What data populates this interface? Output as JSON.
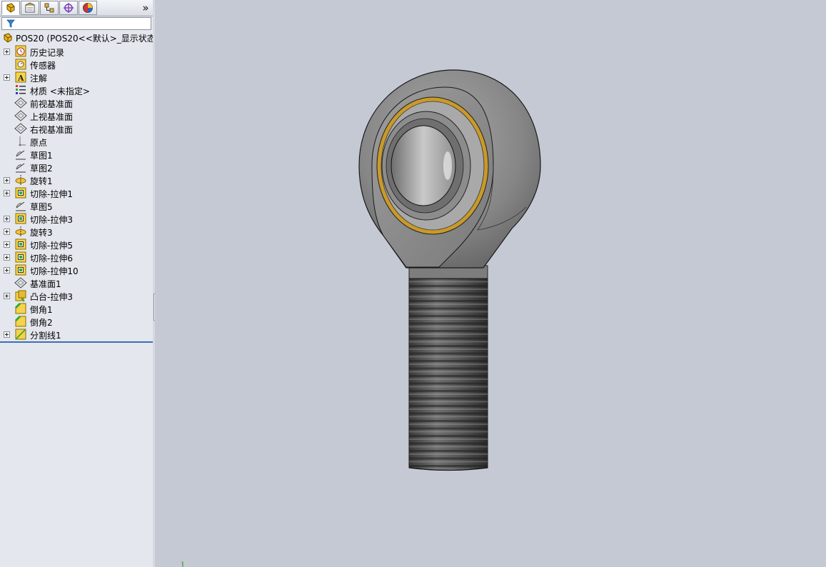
{
  "tabs": [
    {
      "name": "featuremanager",
      "icon": "part-icon",
      "active": true
    },
    {
      "name": "propertymanager",
      "icon": "property-icon",
      "active": false
    },
    {
      "name": "configurationmanager",
      "icon": "configuration-icon",
      "active": false
    },
    {
      "name": "dimxpert",
      "icon": "crosshair-icon",
      "active": false
    },
    {
      "name": "display-manager",
      "icon": "appearance-icon",
      "active": false
    }
  ],
  "tab_more_label": "»",
  "root": {
    "label": "POS20  (POS20<<默认>_显示状态"
  },
  "tree": [
    {
      "label": "历史记录",
      "icon": "history-icon",
      "expandable": true
    },
    {
      "label": "传感器",
      "icon": "sensor-icon",
      "expandable": false
    },
    {
      "label": "注解",
      "icon": "annotation-icon",
      "expandable": true
    },
    {
      "label": "材质 <未指定>",
      "icon": "material-icon",
      "expandable": false
    },
    {
      "label": "前视基准面",
      "icon": "plane-icon",
      "expandable": false
    },
    {
      "label": "上视基准面",
      "icon": "plane-icon",
      "expandable": false
    },
    {
      "label": "右视基准面",
      "icon": "plane-icon",
      "expandable": false
    },
    {
      "label": "原点",
      "icon": "origin-icon",
      "expandable": false
    },
    {
      "label": "草图1",
      "icon": "sketch-icon",
      "expandable": false
    },
    {
      "label": "草图2",
      "icon": "sketch-icon",
      "expandable": false
    },
    {
      "label": "旋转1",
      "icon": "revolve-icon",
      "expandable": true
    },
    {
      "label": "切除-拉伸1",
      "icon": "cut-extrude-icon",
      "expandable": true
    },
    {
      "label": "草图5",
      "icon": "sketch-icon",
      "expandable": false
    },
    {
      "label": "切除-拉伸3",
      "icon": "cut-extrude-icon",
      "expandable": true
    },
    {
      "label": "旋转3",
      "icon": "revolve-icon",
      "expandable": true
    },
    {
      "label": "切除-拉伸5",
      "icon": "cut-extrude-icon",
      "expandable": true
    },
    {
      "label": "切除-拉伸6",
      "icon": "cut-extrude-icon",
      "expandable": true
    },
    {
      "label": "切除-拉伸10",
      "icon": "cut-extrude-icon",
      "expandable": true
    },
    {
      "label": "基准面1",
      "icon": "plane-icon",
      "expandable": false
    },
    {
      "label": "凸台-拉伸3",
      "icon": "boss-extrude-icon",
      "expandable": true
    },
    {
      "label": "倒角1",
      "icon": "chamfer-icon",
      "expandable": false
    },
    {
      "label": "倒角2",
      "icon": "chamfer-icon",
      "expandable": false
    },
    {
      "label": "分割线1",
      "icon": "split-line-icon",
      "expandable": true
    }
  ],
  "colors": {
    "panel_bg": "#e4e7ed",
    "viewport_bg": "#c5c9d3",
    "selection_line": "#3a6fb8",
    "brass_ring": "#c99a2a",
    "steel": "#8a8a8a"
  }
}
